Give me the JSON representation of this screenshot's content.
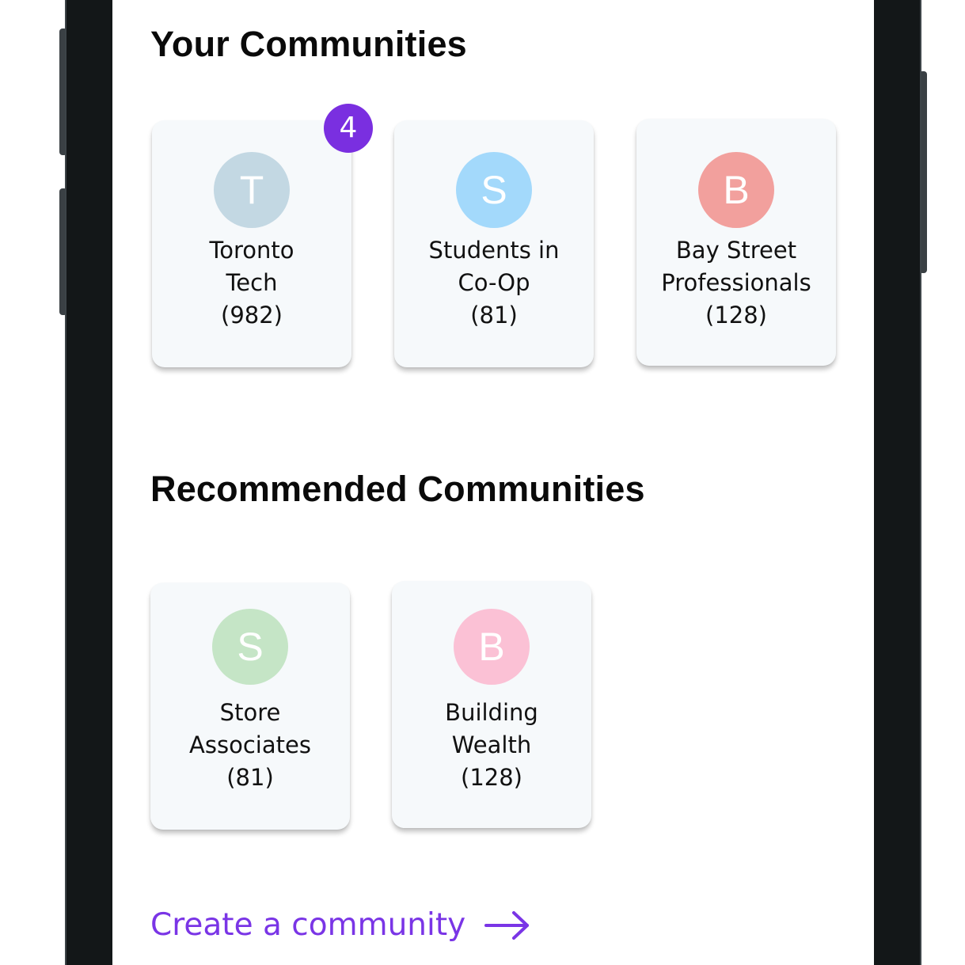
{
  "sections": {
    "your_title": "Your Communities",
    "recommended_title": "Recommended Communities"
  },
  "your_communities": [
    {
      "initial": "T",
      "name_lines": [
        "Toronto",
        "Tech"
      ],
      "count": "(982)",
      "avatar_color": "#c3d8e3",
      "badge": "4"
    },
    {
      "initial": "S",
      "name_lines": [
        "Students in",
        "Co-Op"
      ],
      "count": "(81)",
      "avatar_color": "#a3d9fb"
    },
    {
      "initial": "B",
      "name_lines": [
        "Bay Street",
        "Professionals"
      ],
      "count": "(128)",
      "avatar_color": "#f2a09d"
    }
  ],
  "recommended_communities": [
    {
      "initial": "S",
      "name_lines": [
        "Store",
        "Associates"
      ],
      "count": "(81)",
      "avatar_color": "#c5e5c6"
    },
    {
      "initial": "B",
      "name_lines": [
        "Building",
        "Wealth"
      ],
      "count": "(128)",
      "avatar_color": "#fbc1d5"
    }
  ],
  "create_link": {
    "label": "Create a community",
    "icon": "arrow-right-icon"
  },
  "colors": {
    "accent": "#7a35e6",
    "badge": "#7a2fe0",
    "card_bg": "#f6f9fb",
    "phone_frame": "#131718"
  }
}
